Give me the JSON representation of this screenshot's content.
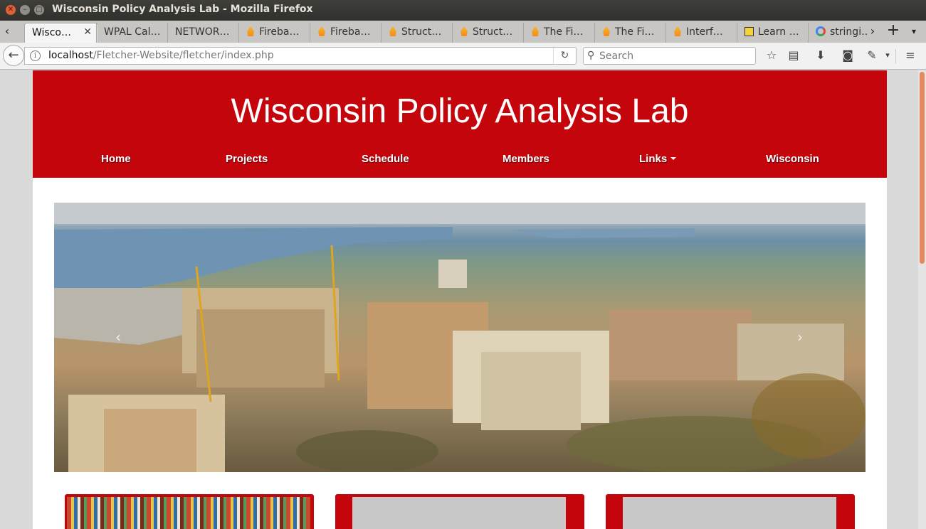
{
  "window": {
    "title": "Wisconsin Policy Analysis Lab - Mozilla Firefox"
  },
  "tabs": [
    {
      "label": "Wisco…",
      "active": true,
      "icon": "page-icon"
    },
    {
      "label": "WPAL Cal…",
      "icon": "none"
    },
    {
      "label": "NETWOR…",
      "icon": "none"
    },
    {
      "label": "Fireba…",
      "icon": "firebase-icon"
    },
    {
      "label": "Fireba…",
      "icon": "firebase-icon"
    },
    {
      "label": "Struct…",
      "icon": "firebase-icon"
    },
    {
      "label": "Struct…",
      "icon": "firebase-icon"
    },
    {
      "label": "The Fi…",
      "icon": "firebase-icon"
    },
    {
      "label": "The Fi…",
      "icon": "firebase-icon"
    },
    {
      "label": "Interf…",
      "icon": "firebase-icon"
    },
    {
      "label": "Learn …",
      "icon": "learn-icon"
    },
    {
      "label": "stringi…",
      "icon": "google-icon"
    }
  ],
  "urlbar": {
    "host": "localhost",
    "path": "/Fletcher-Website/fletcher/index.php"
  },
  "search": {
    "placeholder": "Search"
  },
  "site": {
    "title": "Wisconsin Policy Analysis Lab",
    "nav": [
      {
        "label": "Home"
      },
      {
        "label": "Projects"
      },
      {
        "label": "Schedule"
      },
      {
        "label": "Members"
      },
      {
        "label": "Links",
        "dropdown": true
      },
      {
        "label": "Wisconsin"
      }
    ]
  },
  "colors": {
    "brand_red": "#c5050c",
    "scroll_thumb": "#e8895d"
  }
}
